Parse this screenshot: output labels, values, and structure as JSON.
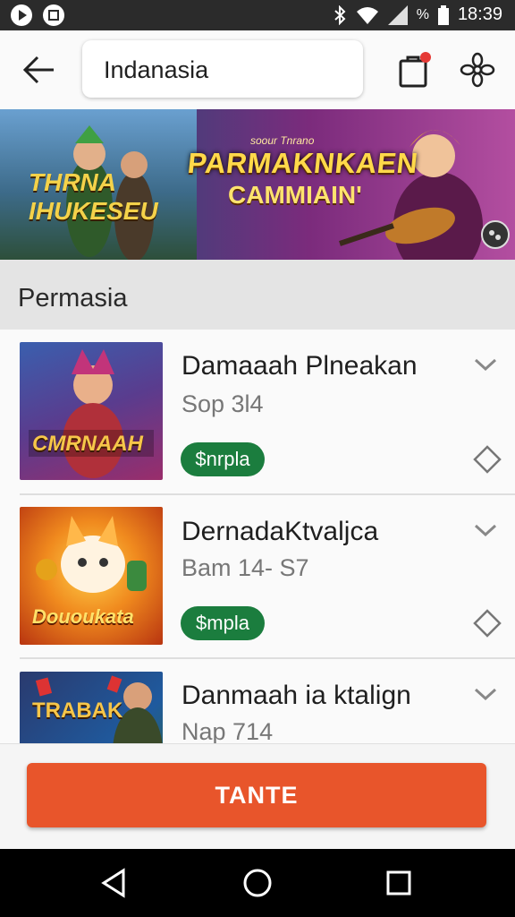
{
  "status_bar": {
    "time": "18:39",
    "battery_text": "%"
  },
  "top_bar": {
    "search_value": "Indanasia"
  },
  "banner": {
    "logo_line1": "THRNA",
    "logo_line2": "IHUKESEU",
    "kicker": "soour Tnrano",
    "title": "PARMAKNKAEN",
    "subtitle": "CAMMIAIN'"
  },
  "section": {
    "title": "Permasia"
  },
  "items": [
    {
      "title": "Damaaah Plneakan",
      "subtitle": "Sop 3l4",
      "tag": "$nrpla",
      "thumb_text": "CMRNAAH",
      "thumb_colors": [
        "#3a5fae",
        "#9a2d6b",
        "#d99a2c"
      ]
    },
    {
      "title": "DernadaKtvaljca",
      "subtitle": "Bam 14- S7",
      "tag": "$mpla",
      "thumb_text": "Dououkata",
      "thumb_colors": [
        "#f08a1e",
        "#e24a14",
        "#ffd14a"
      ]
    },
    {
      "title": "Danmaah ia ktalign",
      "subtitle": "Nap 714",
      "tag": "",
      "thumb_text": "TRABAK",
      "thumb_colors": [
        "#2a3a6e",
        "#1f5a9e",
        "#f2c84a"
      ]
    }
  ],
  "cta": {
    "label": "TANTE",
    "color": "#e8552b"
  },
  "colors": {
    "tag_green": "#1b7d3e",
    "accent_red": "#e8552b"
  }
}
